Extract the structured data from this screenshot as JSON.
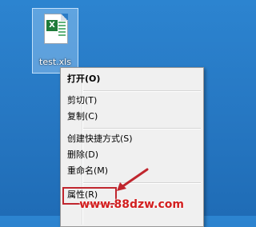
{
  "desktop": {
    "file": {
      "name": "test.xls",
      "icon": "excel-file-icon"
    }
  },
  "context_menu": {
    "items": [
      {
        "label": "打开(O)",
        "bold": true
      },
      {
        "label": "剪切(T)"
      },
      {
        "label": "复制(C)"
      },
      {
        "label": "创建快捷方式(S)"
      },
      {
        "label": "删除(D)"
      },
      {
        "label": "重命名(M)"
      },
      {
        "label": "属性(R)"
      }
    ]
  },
  "annotation": {
    "color": "#c0262e"
  },
  "watermark": {
    "text": "www.88dzw.com",
    "color": "#d21f1f"
  }
}
